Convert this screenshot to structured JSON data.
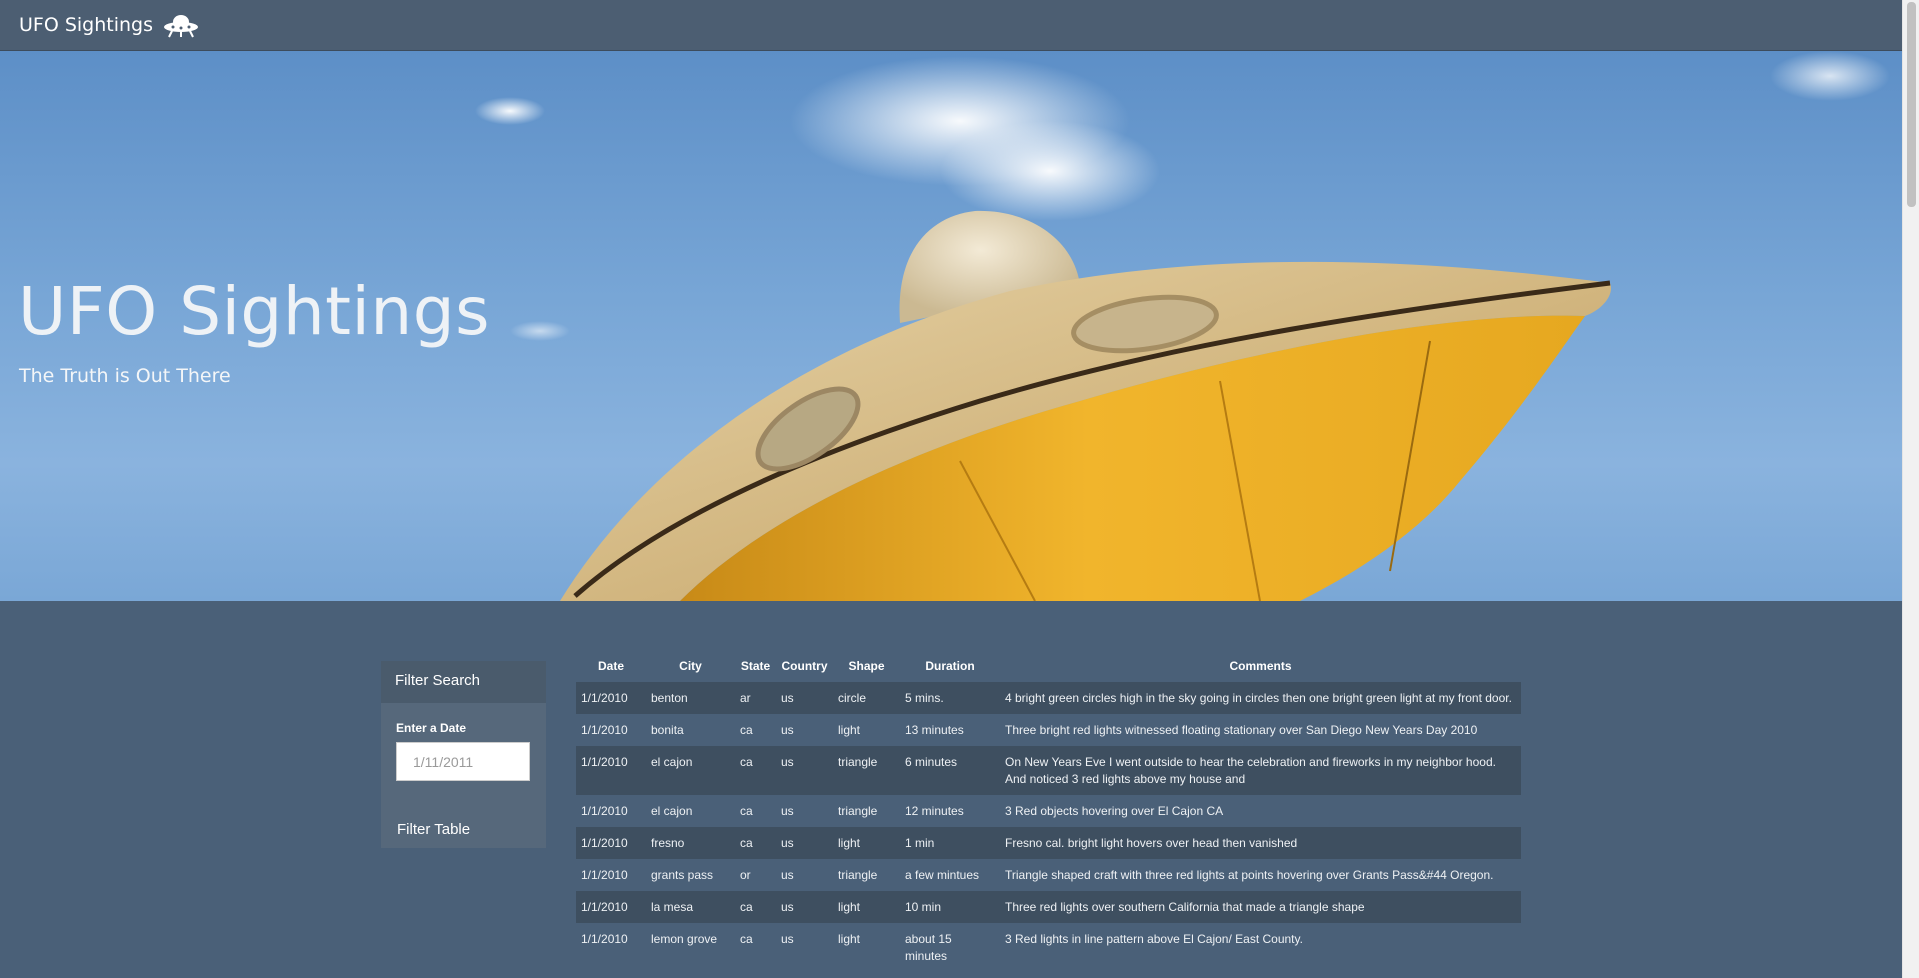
{
  "navbar": {
    "brand": "UFO Sightings",
    "icon": "ufo-icon"
  },
  "hero": {
    "title": "UFO Sightings",
    "subtitle": "The Truth is Out There"
  },
  "filter": {
    "heading": "Filter Search",
    "date_label": "Enter a Date",
    "date_placeholder": "1/11/2011",
    "button_label": "Filter Table"
  },
  "table": {
    "headers": [
      "Date",
      "City",
      "State",
      "Country",
      "Shape",
      "Duration",
      "Comments"
    ],
    "rows": [
      [
        "1/1/2010",
        "benton",
        "ar",
        "us",
        "circle",
        "5 mins.",
        "4 bright green circles high in the sky going in circles then one bright green light at my front door."
      ],
      [
        "1/1/2010",
        "bonita",
        "ca",
        "us",
        "light",
        "13 minutes",
        "Three bright red lights witnessed floating stationary over San Diego New Years Day 2010"
      ],
      [
        "1/1/2010",
        "el cajon",
        "ca",
        "us",
        "triangle",
        "6 minutes",
        "On New Years Eve I went outside to hear the celebration and fireworks in my neighbor hood. And noticed 3 red lights above my house and"
      ],
      [
        "1/1/2010",
        "el cajon",
        "ca",
        "us",
        "triangle",
        "12 minutes",
        "3 Red objects hovering over El Cajon CA"
      ],
      [
        "1/1/2010",
        "fresno",
        "ca",
        "us",
        "light",
        "1 min",
        "Fresno cal. bright light hovers over head then vanished"
      ],
      [
        "1/1/2010",
        "grants pass",
        "or",
        "us",
        "triangle",
        "a few mintues",
        "Triangle shaped craft with three red lights at points hovering over Grants Pass&#44 Oregon."
      ],
      [
        "1/1/2010",
        "la mesa",
        "ca",
        "us",
        "light",
        "10 min",
        "Three red lights over southern California that made a triangle shape"
      ],
      [
        "1/1/2010",
        "lemon grove",
        "ca",
        "us",
        "light",
        "about 15 minutes",
        "3 Red lights in line pattern above El Cajon/ East County."
      ]
    ]
  }
}
